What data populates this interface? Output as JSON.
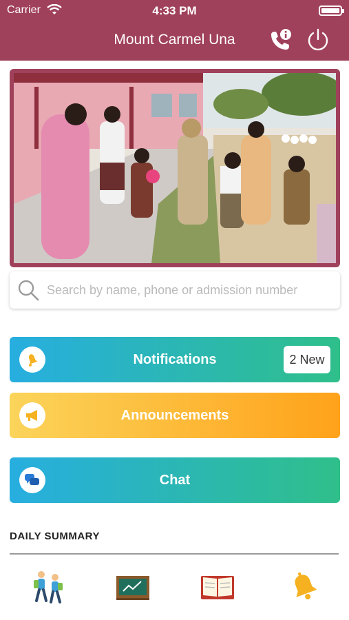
{
  "status_bar": {
    "carrier": "Carrier",
    "time": "4:33 PM"
  },
  "header": {
    "title": "Mount Carmel Una",
    "call_icon": "phone-info-icon",
    "power_icon": "power-icon",
    "background_color": "#a0415c"
  },
  "banner": {
    "image": "school-photo-students-with-officer"
  },
  "search": {
    "placeholder": "Search by name, phone or admission number",
    "value": ""
  },
  "actions": {
    "notifications": {
      "label": "Notifications",
      "badge": "2 New",
      "icon": "bell-icon"
    },
    "announcements": {
      "label": "Announcements",
      "icon": "megaphone-icon"
    },
    "chat": {
      "label": "Chat",
      "icon": "chat-bubbles-icon"
    }
  },
  "daily_summary": {
    "title": "DAILY SUMMARY",
    "items": [
      {
        "icon": "students-walking-icon"
      },
      {
        "icon": "chalkboard-icon"
      },
      {
        "icon": "book-icon"
      },
      {
        "icon": "bell-icon"
      }
    ]
  },
  "colors": {
    "accent": "#a0415c",
    "blue": "#27aee0",
    "green": "#2fbf8a",
    "yellow": "#fbd45a",
    "orange": "#ffa21a"
  }
}
